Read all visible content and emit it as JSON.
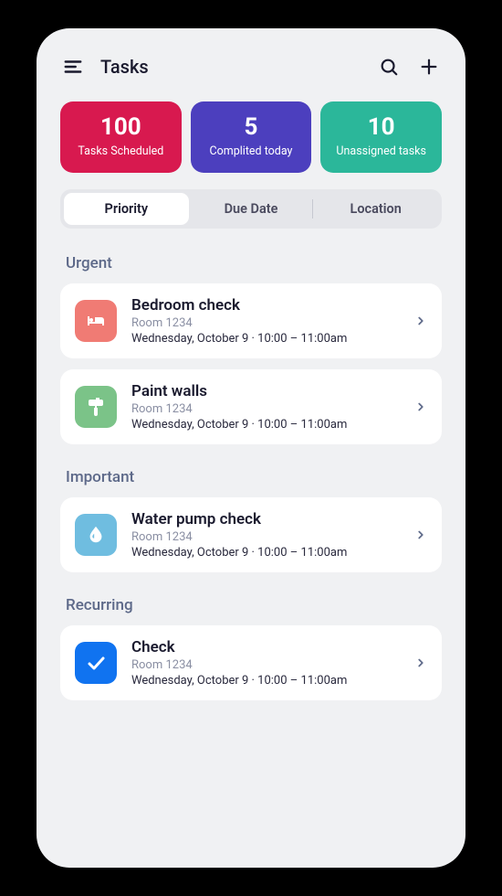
{
  "header": {
    "title": "Tasks"
  },
  "stats": [
    {
      "value": "100",
      "label": "Tasks Scheduled",
      "color": "pink"
    },
    {
      "value": "5",
      "label": "Complited today",
      "color": "purple"
    },
    {
      "value": "10",
      "label": "Unassigned tasks",
      "color": "teal"
    }
  ],
  "tabs": [
    {
      "label": "Priority",
      "active": true
    },
    {
      "label": "Due Date",
      "active": false
    },
    {
      "label": "Location",
      "active": false
    }
  ],
  "sections": [
    {
      "title": "Urgent",
      "tasks": [
        {
          "icon": "bed",
          "color": "coral",
          "title": "Bedroom check",
          "subtitle": "Room 1234",
          "time": "Wednesday, October 9 · 10:00 – 11:00am"
        },
        {
          "icon": "paint",
          "color": "green",
          "title": "Paint walls",
          "subtitle": "Room 1234",
          "time": "Wednesday, October 9 · 10:00 – 11:00am"
        }
      ]
    },
    {
      "title": "Important",
      "tasks": [
        {
          "icon": "drop",
          "color": "sky",
          "title": "Water pump check",
          "subtitle": "Room 1234",
          "time": "Wednesday, October 9 · 10:00 – 11:00am"
        }
      ]
    },
    {
      "title": "Recurring",
      "tasks": [
        {
          "icon": "check",
          "color": "blue",
          "title": "Check",
          "subtitle": "Room 1234",
          "time": "Wednesday, October 9 · 10:00 – 11:00am"
        }
      ]
    }
  ]
}
